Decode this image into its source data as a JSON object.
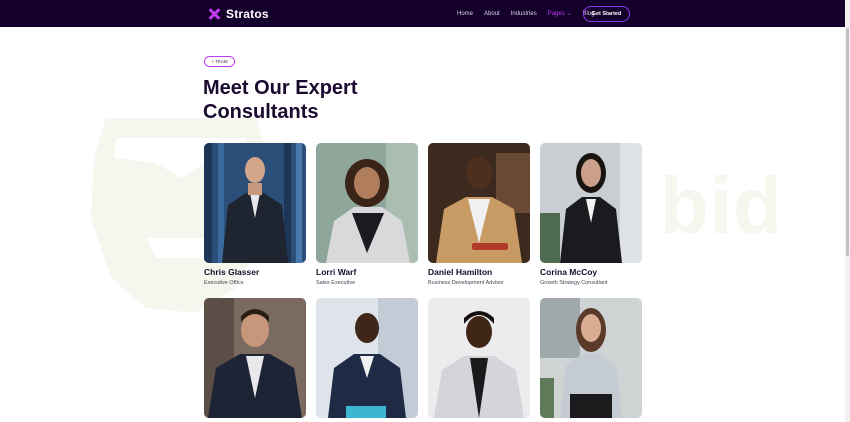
{
  "nav": {
    "brand": "Stratos",
    "links": [
      "Home",
      "About",
      "Industries",
      "Pages",
      "Blog"
    ],
    "cta": "Get Started"
  },
  "section": {
    "badge": "+ TEAM",
    "title": "Meet Our Expert Consultants"
  },
  "watermark": "bid",
  "team": [
    {
      "name": "Chris Glasser",
      "role": "Executive Office"
    },
    {
      "name": "Lorri Warf",
      "role": "Sales Executive"
    },
    {
      "name": "Daniel Hamilton",
      "role": "Business Development Advisor"
    },
    {
      "name": "Corina McCoy",
      "role": "Growth Strategy Consultant"
    },
    {
      "name": "",
      "role": ""
    },
    {
      "name": "",
      "role": ""
    },
    {
      "name": "",
      "role": ""
    },
    {
      "name": "",
      "role": ""
    }
  ]
}
